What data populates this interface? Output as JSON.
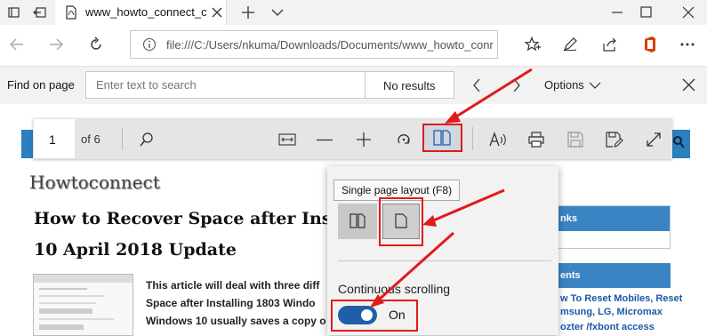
{
  "browser": {
    "tab_title": "www_howto_connect_c",
    "address": "file:///C:/Users/nkuma/Downloads/Documents/www_howto_conr"
  },
  "find_bar": {
    "label": "Find on page",
    "placeholder": "Enter text to search",
    "results": "No results",
    "options": "Options"
  },
  "pdf_toolbar": {
    "page_number": "1",
    "page_total": "of 6"
  },
  "popup": {
    "tooltip": "Single page layout (F8)",
    "continuous_scrolling_label": "Continuous scrolling",
    "toggle_state": "On"
  },
  "document": {
    "site_name": "Howtoconnect",
    "heading_line1": "How to Recover Space after Installi",
    "heading_line2": "10 April 2018 Update",
    "body_lines": [
      "This article will deal with three diff",
      "Space after Installing 1803 Windo",
      "Windows 10 usually saves a copy o"
    ],
    "sidebar_box1_heading": "nks",
    "sidebar_box2_heading": "ents",
    "sidebar_links": [
      "w To Reset Mobiles, Reset",
      "msung, LG, Micromax",
      "ozter /fxbont access"
    ]
  },
  "colors": {
    "annotation_red": "#e01b1b",
    "toggle_blue": "#1f5faa",
    "site_blue": "#2a7fbf"
  }
}
